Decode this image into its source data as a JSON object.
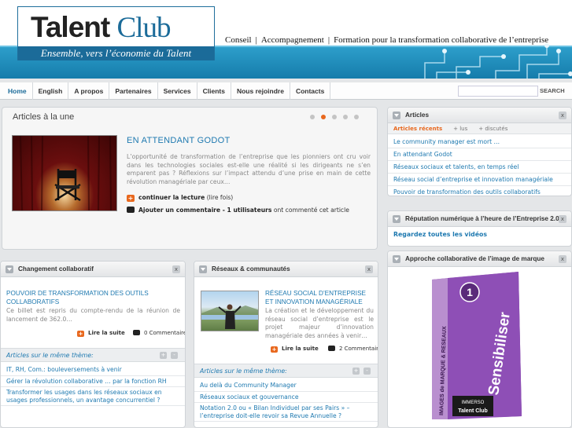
{
  "brand": {
    "name_part1": "Talent",
    "name_part2": "Club",
    "tagline": "Ensemble, vers l’économie du Talent",
    "header_links": [
      "Conseil",
      "Accompagnement",
      "Formation pour la transformation collaborative de l’entreprise"
    ],
    "accent_color": "#1b6b99",
    "orange": "#e8681e"
  },
  "nav": {
    "items": [
      "Home",
      "English",
      "A propos",
      "Partenaires",
      "Services",
      "Clients",
      "Nous rejoindre",
      "Contacts"
    ],
    "search_value": "",
    "search_button": "SEARCH"
  },
  "featured": {
    "section_title": "Articles à la une",
    "slides_count": 5,
    "active_slide": 2,
    "heading": "EN ATTENDANT GODOT",
    "text": "L’opportunité de transformation de l’entreprise que les pionniers ont cru voir dans les technologies sociales est-elle une réalité si les dirigeants ne s’en emparent pas ? Réflexions sur l’impact attendu d’une prise en main de cette révolution managériale par ceux…",
    "read_more": "continuer la lecture",
    "read_count": "(lire fois)",
    "comment_action": "Ajouter un commentaire - 1 utilisateurs",
    "comment_suffix": "ont commenté cet article"
  },
  "changement": {
    "title": "Changement collaboratif",
    "close": "x",
    "article_title": "POUVOIR DE TRANSFORMATION DES OUTILS COLLABORATIFS",
    "article_text": "Ce billet est repris du compte-rendu de la réunion de lancement de 362.0…",
    "read_more": "Lire la suite",
    "comments": "0 Commentaires",
    "theme_label": "Articles sur le même thème:",
    "theme_links": [
      "IT, RH, Com.: bouleversements à venir",
      "Gérer la révolution collaborative … par la fonction RH",
      "Transformer les usages dans les réseaux sociaux en usages professionnels, un avantage concurrentiel ?"
    ]
  },
  "reseaux": {
    "title": "Réseaux & communautés",
    "close": "x",
    "article_title": "RÉSEAU SOCIAL D’ENTREPRISE ET INNOVATION MANAGÉRIALE",
    "article_text": "La création et le développement du réseau social d’entreprise est le projet majeur d’innovation managériale des années à venir…",
    "read_more": "Lire la suite",
    "comments": "2 Commentaires",
    "theme_label": "Articles sur le même thème:",
    "theme_links": [
      "Au delà du Community Manager",
      "Réseaux sociaux et gouvernance",
      "Notation 2.0 ou « Bilan Individuel par ses Pairs » – l’entreprise doit-elle revoir sa Revue Annuelle ?"
    ]
  },
  "articles": {
    "title": "Articles",
    "close": "x",
    "tabs": [
      "Articles récents",
      "+ lus",
      "+ discutés"
    ],
    "links": [
      "Le community manager est mort …",
      "En attendant Godot",
      "Réseaux sociaux et talents, en temps réel",
      "Réseau social d’entreprise et innovation managériale",
      "Pouvoir de transformation des outils collaboratifs"
    ]
  },
  "reputation": {
    "title": "Réputation numérique à l’heure de l’Entreprise 2.0",
    "close": "x",
    "link": "Regardez toutes les vidéos"
  },
  "approche": {
    "title": "Approche collaborative de l’image de marque",
    "close": "x",
    "book_number": "1",
    "book_word": "Sensibiliser",
    "book_spine": "IMAGES de MARQUE & RESEAUX",
    "book_brand": "IMMERSO",
    "book_brand2": "Talent Club"
  }
}
